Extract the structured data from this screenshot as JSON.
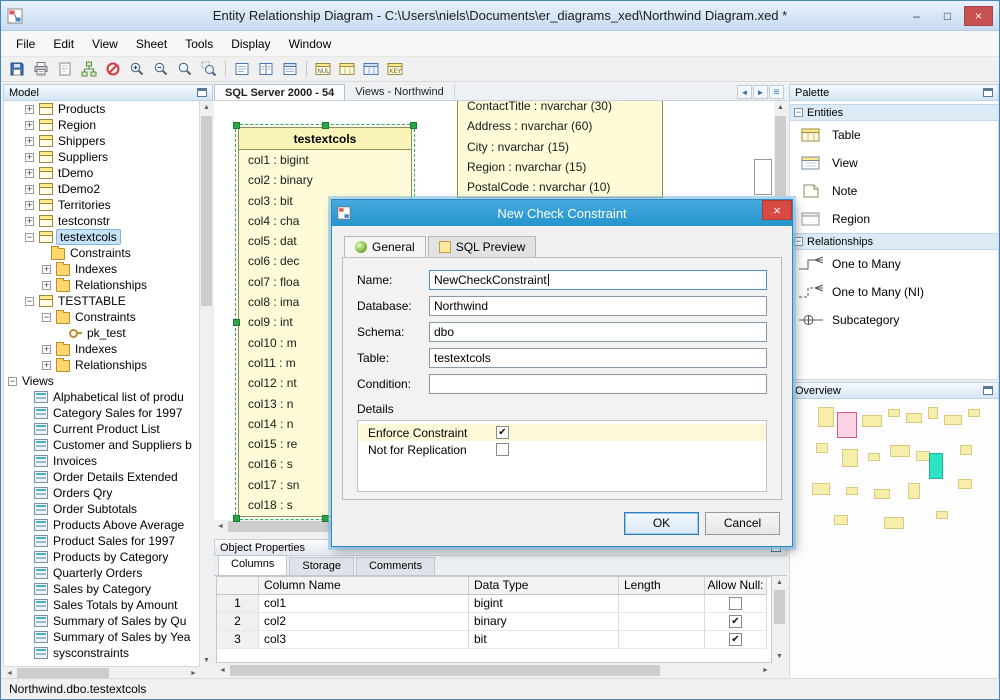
{
  "window": {
    "title": "Entity Relationship Diagram - C:\\Users\\niels\\Documents\\er_diagrams_xed\\Northwind Diagram.xed *"
  },
  "menubar": {
    "items": [
      "File",
      "Edit",
      "View",
      "Sheet",
      "Tools",
      "Display",
      "Window"
    ]
  },
  "toolbar": {
    "buttons": [
      "save",
      "print",
      "new-sheet",
      "model-structure",
      "hide-object",
      "zoom-in",
      "zoom-out",
      "zoom-actual",
      "zoom-region",
      "|",
      "display-names",
      "display-columns",
      "display-header",
      "|",
      "table-null",
      "table-columns",
      "table-blue",
      "table-key"
    ]
  },
  "sheet_tabs": {
    "tabs": [
      {
        "label": "SQL Server 2000 - 54",
        "active": true
      },
      {
        "label": "Views - Northwind",
        "active": false
      }
    ]
  },
  "model_panel": {
    "title": "Model",
    "tree": [
      {
        "label": "Products",
        "level": 1,
        "expand": "plus",
        "icon": "table"
      },
      {
        "label": "Region",
        "level": 1,
        "expand": "plus",
        "icon": "table"
      },
      {
        "label": "Shippers",
        "level": 1,
        "expand": "plus",
        "icon": "table"
      },
      {
        "label": "Suppliers",
        "level": 1,
        "expand": "plus",
        "icon": "table"
      },
      {
        "label": "tDemo",
        "level": 1,
        "expand": "plus",
        "icon": "table"
      },
      {
        "label": "tDemo2",
        "level": 1,
        "expand": "plus",
        "icon": "table"
      },
      {
        "label": "Territories",
        "level": 1,
        "expand": "plus",
        "icon": "table"
      },
      {
        "label": "testconstr",
        "level": 1,
        "expand": "plus",
        "icon": "table"
      },
      {
        "label": "testextcols",
        "level": 1,
        "expand": "minus",
        "icon": "table",
        "selected": true
      },
      {
        "label": "Constraints",
        "level": 2,
        "expand": "none",
        "icon": "folder"
      },
      {
        "label": "Indexes",
        "level": 2,
        "expand": "plus",
        "icon": "folder"
      },
      {
        "label": "Relationships",
        "level": 2,
        "expand": "plus",
        "icon": "folder"
      },
      {
        "label": "TESTTABLE",
        "level": 1,
        "expand": "minus",
        "icon": "table"
      },
      {
        "label": "Constraints",
        "level": 2,
        "expand": "minus",
        "icon": "folder"
      },
      {
        "label": "pk_test",
        "level": 3,
        "expand": "none",
        "icon": "key"
      },
      {
        "label": "Indexes",
        "level": 2,
        "expand": "plus",
        "icon": "folder"
      },
      {
        "label": "Relationships",
        "level": 2,
        "expand": "plus",
        "icon": "folder"
      },
      {
        "label": "Views",
        "level": 0,
        "expand": "minus",
        "icon": "none"
      },
      {
        "label": "Alphabetical list of produ",
        "level": 1,
        "expand": "none",
        "icon": "viewobj"
      },
      {
        "label": "Category Sales for 1997",
        "level": 1,
        "expand": "none",
        "icon": "viewobj"
      },
      {
        "label": "Current Product List",
        "level": 1,
        "expand": "none",
        "icon": "viewobj"
      },
      {
        "label": "Customer and Suppliers b",
        "level": 1,
        "expand": "none",
        "icon": "viewobj"
      },
      {
        "label": "Invoices",
        "level": 1,
        "expand": "none",
        "icon": "viewobj"
      },
      {
        "label": "Order Details Extended",
        "level": 1,
        "expand": "none",
        "icon": "viewobj"
      },
      {
        "label": "Orders Qry",
        "level": 1,
        "expand": "none",
        "icon": "viewobj"
      },
      {
        "label": "Order Subtotals",
        "level": 1,
        "expand": "none",
        "icon": "viewobj"
      },
      {
        "label": "Products Above Average",
        "level": 1,
        "expand": "none",
        "icon": "viewobj"
      },
      {
        "label": "Product Sales for 1997",
        "level": 1,
        "expand": "none",
        "icon": "viewobj"
      },
      {
        "label": "Products by Category",
        "level": 1,
        "expand": "none",
        "icon": "viewobj"
      },
      {
        "label": "Quarterly Orders",
        "level": 1,
        "expand": "none",
        "icon": "viewobj"
      },
      {
        "label": "Sales by Category",
        "level": 1,
        "expand": "none",
        "icon": "viewobj"
      },
      {
        "label": "Sales Totals by Amount",
        "level": 1,
        "expand": "none",
        "icon": "viewobj"
      },
      {
        "label": "Summary of Sales by Qu",
        "level": 1,
        "expand": "none",
        "icon": "viewobj"
      },
      {
        "label": "Summary of Sales by Yea",
        "level": 1,
        "expand": "none",
        "icon": "viewobj"
      },
      {
        "label": "sysconstraints",
        "level": 1,
        "expand": "none",
        "icon": "viewobj"
      }
    ]
  },
  "canvas": {
    "selected_entity": {
      "title": "testextcols",
      "columns": [
        "col1 : bigint",
        "col2 : binary",
        "col3 : bit",
        "col4 : cha",
        "col5 : dat",
        "col6 : dec",
        "col7 : floa",
        "col8 : ima",
        "col9 : int",
        "col10 : m",
        "col11 : m",
        "col12 : nt",
        "col13 : n",
        "col14 : n",
        "col15 : re",
        "col16 : s",
        "col17 : sn",
        "col18 : s"
      ]
    },
    "partial_entity": {
      "columns": [
        "ContactTitle : nvarchar (30)",
        "Address : nvarchar (60)",
        "City : nvarchar (15)",
        "Region : nvarchar (15)",
        "PostalCode : nvarchar (10)"
      ]
    }
  },
  "dialog": {
    "title": "New Check Constraint",
    "tabs": [
      {
        "label": "General",
        "active": true
      },
      {
        "label": "SQL Preview",
        "active": false
      }
    ],
    "fields": [
      {
        "label": "Name:",
        "value": "NewCheckConstraint",
        "caret": true
      },
      {
        "label": "Database:",
        "value": "Northwind"
      },
      {
        "label": "Schema:",
        "value": "dbo"
      },
      {
        "label": "Table:",
        "value": "testextcols"
      },
      {
        "label": "Condition:",
        "value": ""
      }
    ],
    "details_label": "Details",
    "options": [
      {
        "label": "Enforce Constraint",
        "checked": true,
        "highlight": true
      },
      {
        "label": "Not for Replication",
        "checked": false,
        "highlight": false
      }
    ],
    "ok_label": "OK",
    "cancel_label": "Cancel"
  },
  "palette_panel": {
    "title": "Palette",
    "sections": [
      {
        "label": "Entities",
        "items": [
          {
            "label": "Table",
            "icon": "table"
          },
          {
            "label": "View",
            "icon": "view"
          },
          {
            "label": "Note",
            "icon": "note"
          },
          {
            "label": "Region",
            "icon": "region"
          }
        ]
      },
      {
        "label": "Relationships",
        "items": [
          {
            "label": "One to Many",
            "icon": "one-to-many"
          },
          {
            "label": "One to Many (NI)",
            "icon": "one-to-many-ni"
          },
          {
            "label": "Subcategory",
            "icon": "subcategory"
          }
        ]
      }
    ]
  },
  "overview_panel": {
    "title": "Overview"
  },
  "object_properties": {
    "title": "Object Properties",
    "tabs": [
      {
        "label": "Columns",
        "active": true
      },
      {
        "label": "Storage",
        "active": false
      },
      {
        "label": "Comments",
        "active": false
      }
    ],
    "grid": {
      "headers": [
        "Column Name",
        "Data Type",
        "Length",
        "Allow Null:"
      ],
      "rows": [
        {
          "num": "1",
          "name": "col1",
          "type": "bigint",
          "length": "",
          "allow_null": false
        },
        {
          "num": "2",
          "name": "col2",
          "type": "binary",
          "length": "",
          "allow_null": true
        },
        {
          "num": "3",
          "name": "col3",
          "type": "bit",
          "length": "",
          "allow_null": true
        }
      ]
    }
  },
  "statusbar": {
    "text": "Northwind.dbo.testextcols"
  },
  "colors": {
    "entity_fill": "#fdfbd8",
    "entity_border": "#8f8f55",
    "selection_handles": "#28a745",
    "dialog_titlebar": "#2f9fd8",
    "close_button": "#d94a43",
    "minimap_entity": "#f6eeaa",
    "minimap_highlight": "#2fe4c4",
    "minimap_viewport": "#e05587"
  }
}
